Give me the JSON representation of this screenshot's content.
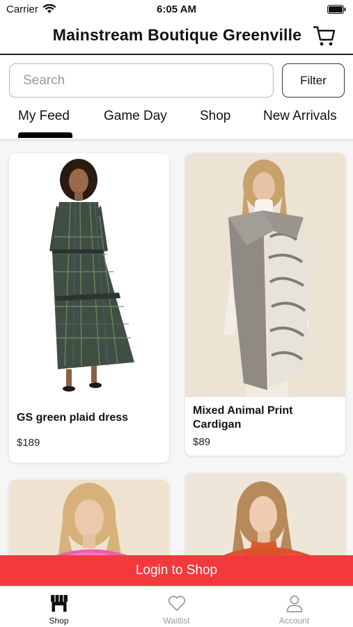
{
  "status_bar": {
    "carrier": "Carrier",
    "time": "6:05 AM"
  },
  "header": {
    "title": "Mainstream Boutique Greenville",
    "cart_icon": "cart-icon"
  },
  "search": {
    "placeholder": "Search",
    "value": ""
  },
  "filter": {
    "label": "Filter"
  },
  "tabs": [
    {
      "label": "My Feed",
      "active": true
    },
    {
      "label": "Game Day",
      "active": false
    },
    {
      "label": "Shop",
      "active": false
    },
    {
      "label": "New Arrivals",
      "active": false
    }
  ],
  "products": [
    {
      "name": "GS green plaid dress",
      "price": "$189"
    },
    {
      "name": "Mixed Animal Print Cardigan",
      "price": "$89"
    },
    {
      "name": "",
      "price": ""
    },
    {
      "name": "",
      "price": ""
    }
  ],
  "login_banner": {
    "label": "Login to Shop"
  },
  "bottom_nav": [
    {
      "label": "Shop",
      "icon": "store-icon",
      "active": true
    },
    {
      "label": "Waitlist",
      "icon": "heart-icon",
      "active": false
    },
    {
      "label": "Account",
      "icon": "person-icon",
      "active": false
    }
  ],
  "colors": {
    "accent": "#f23a3d",
    "active": "#111111",
    "inactive": "#9b9b9b"
  }
}
